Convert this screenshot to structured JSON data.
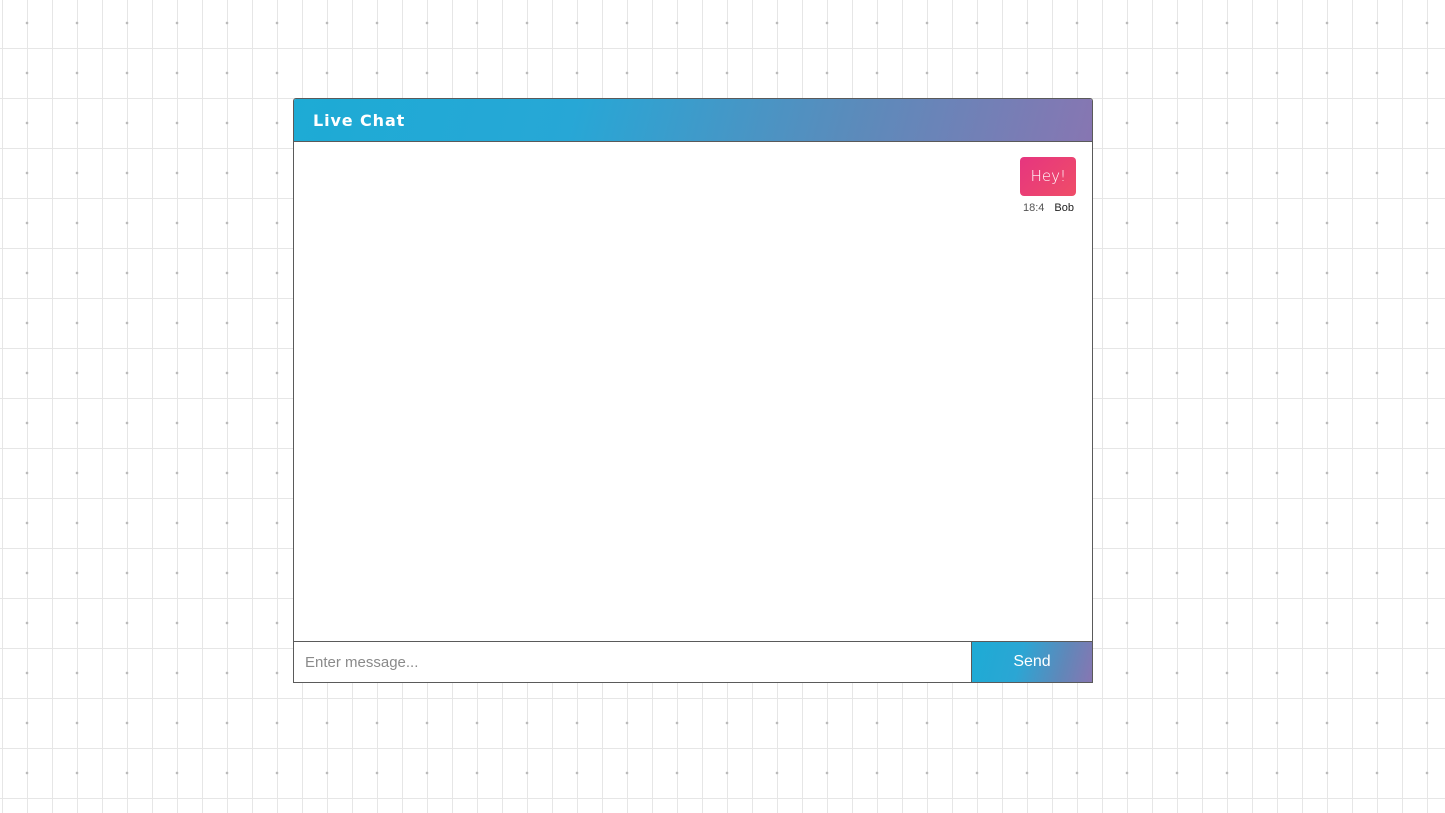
{
  "chat": {
    "title": "Live Chat",
    "messages": [
      {
        "text": "Hey!",
        "time": "18:4",
        "sender": "Bob"
      }
    ],
    "input": {
      "value": "",
      "placeholder": "Enter message..."
    },
    "send_label": "Send"
  },
  "colors": {
    "header_gradient_start": "#1dabd5",
    "header_gradient_end": "#8776b2",
    "bubble_gradient_start": "#e6357f",
    "bubble_gradient_end": "#ef4d68",
    "border": "#5a5a5a"
  }
}
